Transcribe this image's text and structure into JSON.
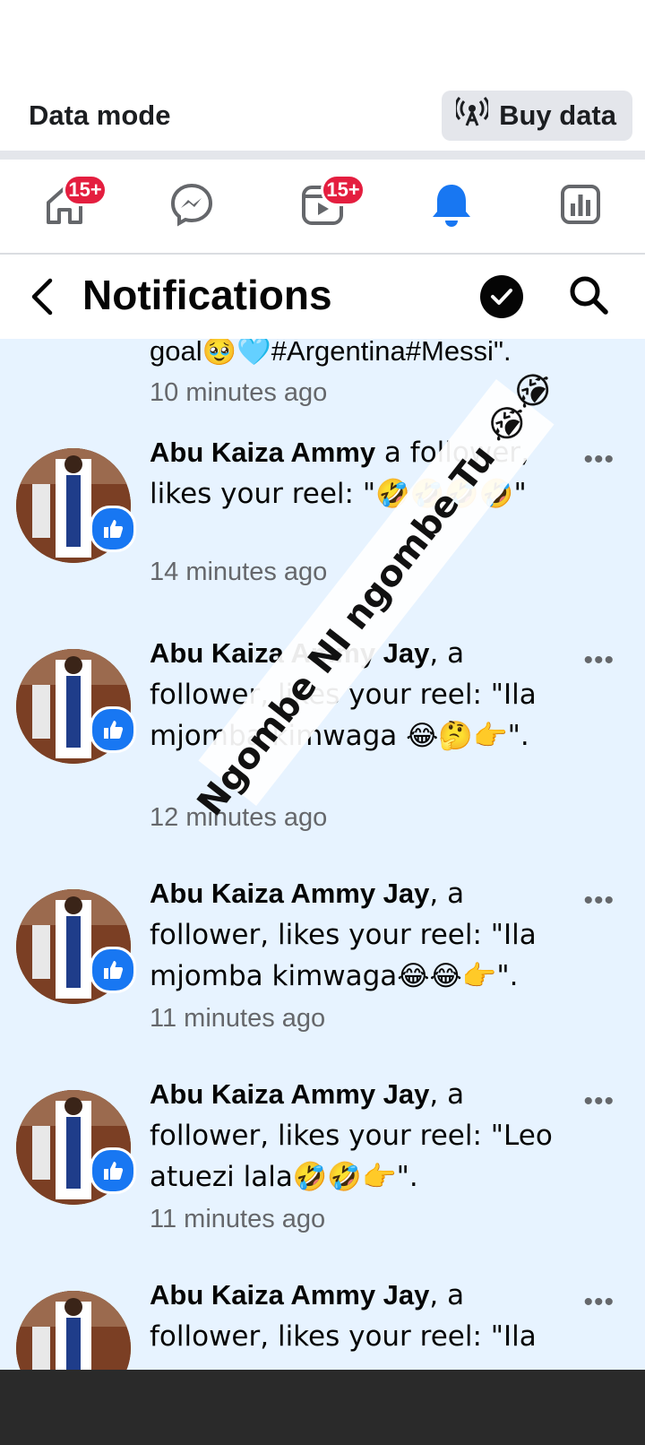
{
  "data_bar": {
    "mode_label": "Data mode",
    "buy_label": "Buy data"
  },
  "tabs": [
    {
      "name": "home",
      "badge": "15+"
    },
    {
      "name": "messenger",
      "badge": ""
    },
    {
      "name": "video",
      "badge": "15+"
    },
    {
      "name": "notifications",
      "badge": ""
    },
    {
      "name": "dashboard",
      "badge": ""
    }
  ],
  "header": {
    "title": "Notifications"
  },
  "partial": {
    "text": "goal🥹🩵#Argentina#Messi\".",
    "time": "10 minutes ago"
  },
  "notifications": [
    {
      "name": "Abu Kaiza Ammy",
      "body": " a follower, likes your reel: \"🤣🤣🤣🤣\"",
      "time": "14 minutes ago"
    },
    {
      "name": "Abu Kaiza Ammy Jay",
      "body": ", a follower, likes your reel: \"Ila mjomba kimwaga 😂🤔👉\".",
      "time": "12 minutes ago"
    },
    {
      "name": "Abu Kaiza Ammy Jay",
      "body": ", a follower, likes your reel: \"Ila mjomba kimwaga😂😂👉\".",
      "time": "11 minutes ago"
    },
    {
      "name": "Abu Kaiza Ammy Jay",
      "body": ", a follower, likes your reel: \"Leo atuezi lala🤣🤣👉\".",
      "time": "11 minutes ago"
    },
    {
      "name": "Abu Kaiza Ammy Jay",
      "body": ", a follower, likes your reel: \"Ila",
      "time": ""
    }
  ],
  "overlay": {
    "text": "Ngombe NI ngombe Tu 😭😭"
  },
  "colors": {
    "brand_blue": "#1877f2",
    "badge_red": "#e41e3f",
    "unread_bg": "#e7f3ff"
  }
}
